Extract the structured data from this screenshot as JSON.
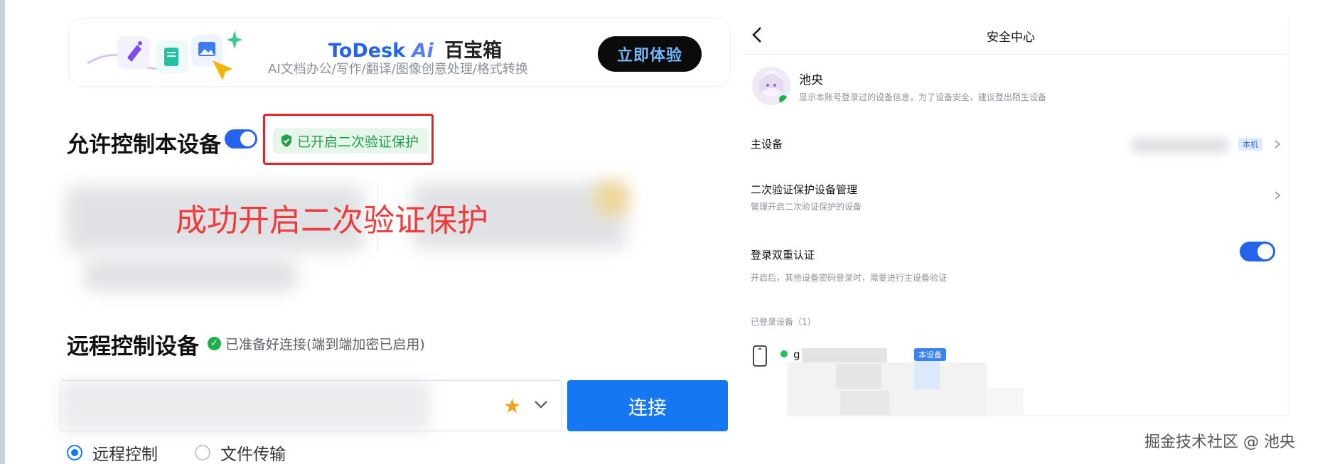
{
  "banner": {
    "title_brand": "ToDesk",
    "title_ai": "Ai",
    "title_cn": "百宝箱",
    "subtitle": "AI文档办公/写作/翻译/图像创意处理/格式转换",
    "cta_label": "立即体验"
  },
  "allow_control": {
    "title": "允许控制本设备",
    "toggle_on": true,
    "badge_label": "已开启二次验证保护"
  },
  "annotation": {
    "success_text": "成功开启二次验证保护"
  },
  "remote_control": {
    "title": "远程控制设备",
    "status_text": "已准备好连接(端到端加密已启用)",
    "connect_label": "连接",
    "modes": [
      {
        "label": "远程控制",
        "selected": true
      },
      {
        "label": "文件传输",
        "selected": false
      }
    ]
  },
  "security_center": {
    "title": "安全中心",
    "user": {
      "name": "池央",
      "description": "显示本账号登录过的设备信息，为了设备安全，建议登出陌生设备"
    },
    "main_device": {
      "label": "主设备",
      "tag": "本机"
    },
    "two_factor_devices": {
      "label": "二次验证保护设备管理",
      "subtitle": "管理开启二次验证保护的设备"
    },
    "login_dual_auth": {
      "label": "登录双重认证",
      "subtitle": "开启后，其他设备密码登录时，需要进行主设备验证",
      "enabled": true
    },
    "logged_in_devices": {
      "header": "已登录设备（1）",
      "devices": [
        {
          "name_visible": "g",
          "tag": "本设备",
          "online": true
        }
      ]
    }
  },
  "watermark": "掘金技术社区 @ 池央",
  "colors": {
    "accent_blue": "#1677f3",
    "toggle_blue": "#2563eb",
    "success_green": "#20a04a",
    "annotation_red": "#ef3b3b",
    "highlight_box_red": "#e0262b"
  }
}
